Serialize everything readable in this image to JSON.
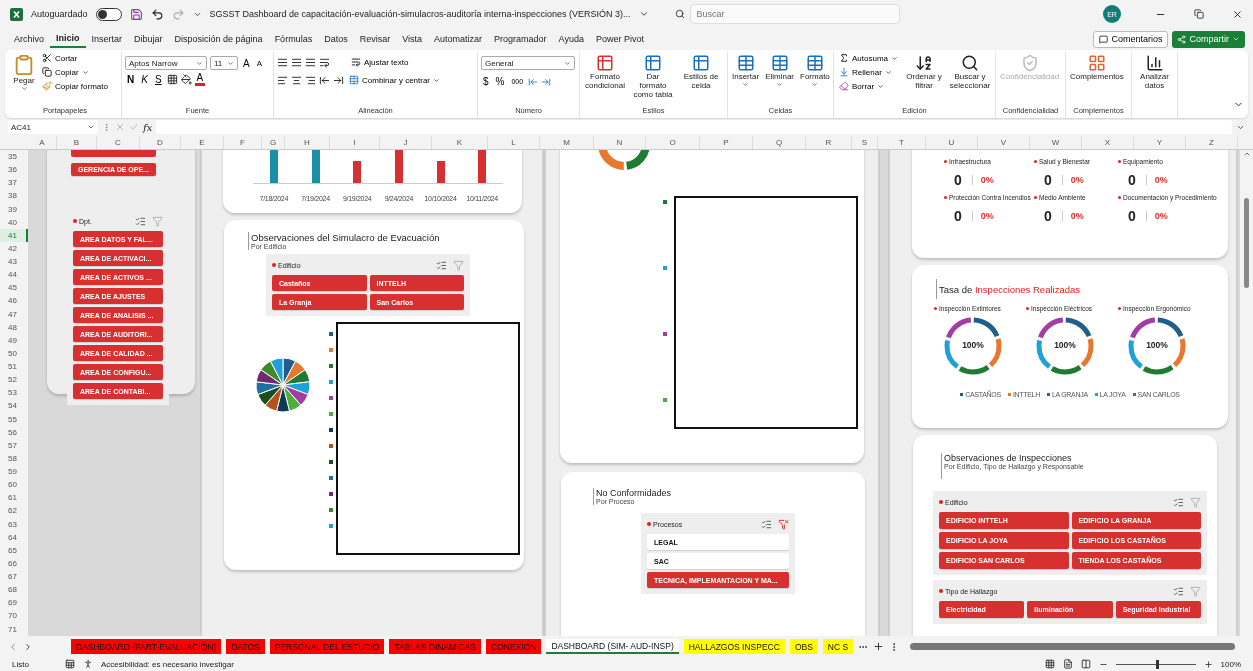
{
  "window": {
    "autosave_label": "Autoguardado",
    "autosave_on": false,
    "title": "SGSST Dashboard de capacitación-evaluación-simulacros-auditoría interna-inspecciones (VERSIÓN 3)...",
    "search_placeholder": "Buscar",
    "avatar": "ER"
  },
  "menu": {
    "tabs": [
      {
        "label": "Archivo",
        "selected": false
      },
      {
        "label": "Inicio",
        "selected": true
      },
      {
        "label": "Insertar",
        "selected": false
      },
      {
        "label": "Dibujar",
        "selected": false
      },
      {
        "label": "Disposición de página",
        "selected": false
      },
      {
        "label": "Fórmulas",
        "selected": false
      },
      {
        "label": "Datos",
        "selected": false
      },
      {
        "label": "Revisar",
        "selected": false
      },
      {
        "label": "Vista",
        "selected": false
      },
      {
        "label": "Automatizar",
        "selected": false
      },
      {
        "label": "Programador",
        "selected": false
      },
      {
        "label": "Ayuda",
        "selected": false
      },
      {
        "label": "Power Pivot",
        "selected": false
      }
    ],
    "comments": "Comentarios",
    "share": "Compartir"
  },
  "ribbon": {
    "clipboard": {
      "paste": "Pegar",
      "cut": "Cortar",
      "copy": "Copiar",
      "format_painter": "Copiar formato",
      "label": "Portapapeles"
    },
    "font": {
      "name": "Aptos Narrow",
      "size": "11",
      "grow": "A",
      "shrink": "A",
      "bold": "N",
      "italic": "K",
      "underline": "S",
      "font_color": "A",
      "label": "Fuente"
    },
    "alignment": {
      "wrap": "Ajustar texto",
      "merge": "Combinar y centrar",
      "label": "Alineación"
    },
    "number": {
      "format": "General",
      "currency": "$",
      "percent": "%",
      "thousands": "000",
      "label": "Número"
    },
    "styles": {
      "items": [
        "Formato condicional",
        "Dar formato como tabla",
        "Estilos de celda"
      ],
      "label": "Estilos"
    },
    "cells": {
      "items": [
        "Insertar",
        "Eliminar",
        "Formato"
      ],
      "label": "Celdas"
    },
    "editing": {
      "autosum": "Autosuma",
      "fill": "Rellenar",
      "clear": "Borrar",
      "sort": "Ordenar y filtrar",
      "find": "Buscar y seleccionar",
      "label": "Edición"
    },
    "sensitivity": {
      "button": "Confidencialidad",
      "disabled": true,
      "label": "Confidencialidad"
    },
    "addins": {
      "button": "Complementos",
      "label": "Complementos"
    },
    "analyze": {
      "button": "Analizar datos"
    }
  },
  "formula_bar": {
    "cell": "AC41",
    "fx": "fx"
  },
  "columns": [
    "A",
    "B",
    "C",
    "D",
    "E",
    "F",
    "G",
    "H",
    "I",
    "J",
    "K",
    "L",
    "M",
    "N",
    "O",
    "P",
    "Q",
    "R",
    "S",
    "T",
    "U",
    "V",
    "W",
    "X",
    "Y",
    "Z"
  ],
  "rows": [
    {
      "n": "35",
      "selected": false
    },
    {
      "n": "36",
      "selected": false
    },
    {
      "n": "37",
      "selected": false
    },
    {
      "n": "38",
      "selected": false
    },
    {
      "n": "39",
      "selected": false
    },
    {
      "n": "40",
      "selected": false
    },
    {
      "n": "41",
      "selected": true
    },
    {
      "n": "42",
      "selected": false
    },
    {
      "n": "43",
      "selected": false
    },
    {
      "n": "44",
      "selected": false
    },
    {
      "n": "45",
      "selected": false
    },
    {
      "n": "46",
      "selected": false
    },
    {
      "n": "47",
      "selected": false
    },
    {
      "n": "48",
      "selected": false
    },
    {
      "n": "49",
      "selected": false
    },
    {
      "n": "50",
      "selected": false
    },
    {
      "n": "51",
      "selected": false
    },
    {
      "n": "52",
      "selected": false
    },
    {
      "n": "53",
      "selected": false
    },
    {
      "n": "54",
      "selected": false
    },
    {
      "n": "55",
      "selected": false
    },
    {
      "n": "56",
      "selected": false
    },
    {
      "n": "57",
      "selected": false
    },
    {
      "n": "58",
      "selected": false
    },
    {
      "n": "59",
      "selected": false
    },
    {
      "n": "60",
      "selected": false
    },
    {
      "n": "61",
      "selected": false
    },
    {
      "n": "62",
      "selected": false
    },
    {
      "n": "63",
      "selected": false
    },
    {
      "n": "64",
      "selected": false
    },
    {
      "n": "65",
      "selected": false
    },
    {
      "n": "66",
      "selected": false
    },
    {
      "n": "67",
      "selected": false
    },
    {
      "n": "68",
      "selected": false
    },
    {
      "n": "69",
      "selected": false
    },
    {
      "n": "70",
      "selected": false
    },
    {
      "n": "71",
      "selected": false
    }
  ],
  "left_panel": {
    "top_items": [
      {
        "label": "GERENCIA DE OPE...",
        "selected": true
      }
    ],
    "dept": {
      "title": "Dpt.",
      "filtered": false,
      "items": [
        {
          "label": "AREA DATOS Y FAL...",
          "selected": true
        },
        {
          "label": "AREA DE ACTIVACI...",
          "selected": true
        },
        {
          "label": "AREA DE ACTIVOS ...",
          "selected": true
        },
        {
          "label": "AREA DE AJUSTES",
          "selected": true
        },
        {
          "label": "AREA DE ANALISIS ...",
          "selected": true
        },
        {
          "label": "AREA DE AUDITORI...",
          "selected": true
        },
        {
          "label": "AREA DE CALIDAD ...",
          "selected": true
        },
        {
          "label": "AREA DE CONFIGU...",
          "selected": true
        },
        {
          "label": "AREA DE CONTABI...",
          "selected": true
        }
      ]
    }
  },
  "bar_card": {
    "bars": [
      {
        "date": "7/18/2024",
        "color": "#1a8fa6"
      },
      {
        "date": "7/19/2024",
        "color": "#1a8fa6"
      },
      {
        "date": "9/19/2024",
        "color": "#d63030"
      },
      {
        "date": "9/24/2024",
        "color": "#d63030"
      },
      {
        "date": "10/10/2024",
        "color": "#d63030"
      },
      {
        "date": "10/11/2024",
        "color": "#d63030"
      }
    ]
  },
  "simulacro_card": {
    "title": "Observaciones del Simulacro de Evacuación",
    "subtitle": "Por Edificio",
    "slicer": {
      "title": "Edificio",
      "filtered": false,
      "items": [
        {
          "label": "Castaños",
          "selected": true
        },
        {
          "label": "INTTELH",
          "selected": true
        },
        {
          "label": "La Granja",
          "selected": true
        },
        {
          "label": "San Carlos",
          "selected": true
        }
      ]
    },
    "legend": [
      {
        "color": "#1f5f8b"
      },
      {
        "color": "#e8782f"
      },
      {
        "color": "#217a33"
      },
      {
        "color": "#1da1d8"
      },
      {
        "color": "#a23ca6"
      },
      {
        "color": "#4caf3a"
      },
      {
        "color": "#0f3b57"
      },
      {
        "color": "#b5521b"
      },
      {
        "color": "#1b4d1e"
      },
      {
        "color": "#1f6fa0"
      },
      {
        "color": "#6d2a6f"
      },
      {
        "color": "#3c8a2a"
      },
      {
        "color": "#1da1d8"
      }
    ]
  },
  "middle_card": {
    "legend": [
      {
        "color": "#217a33"
      },
      {
        "color": "#1da1d8"
      },
      {
        "color": "#a23ca6"
      },
      {
        "color": "#4caf3a"
      }
    ]
  },
  "nc_card": {
    "title": "No Conformidades",
    "subtitle": "Por Proceso",
    "slicer": {
      "title": "Procesos",
      "filtered": true,
      "items": [
        {
          "label": "LEGAL",
          "selected": false
        },
        {
          "label": "SAC",
          "selected": false
        },
        {
          "label": "TECNICA, IMPLEMANTACION Y MA...",
          "selected": true
        }
      ]
    }
  },
  "kpi_card": {
    "items": [
      {
        "label": "Infraestructura",
        "value": "0",
        "percent": "0%"
      },
      {
        "label": "Salud y Bienestar",
        "value": "0",
        "percent": "0%"
      },
      {
        "label": "Equipamiento",
        "value": "0",
        "percent": "0%"
      },
      {
        "label": "Protección Contra Incendios",
        "value": "0",
        "percent": "0%"
      },
      {
        "label": "Medio Ambiente",
        "value": "0",
        "percent": "0%"
      },
      {
        "label": "Documentación y Procedimiento",
        "value": "0",
        "percent": "0%"
      }
    ]
  },
  "tasa_card": {
    "title": "Tasa de **Inspecciones Realizadas**",
    "donuts": [
      {
        "label": "Inspección Extintores",
        "value": "100%"
      },
      {
        "label": "Inspección Eléctricos",
        "value": "100%"
      },
      {
        "label": "Inspección Ergonómico",
        "value": "100%"
      }
    ],
    "legend": [
      {
        "label": "CASTAÑOS",
        "color": "#1f5f8b"
      },
      {
        "label": "INTTELH",
        "color": "#e8782f"
      },
      {
        "label": "LA GRANJA",
        "color": "#217a33"
      },
      {
        "label": "LA JOYA",
        "color": "#1da1d8"
      },
      {
        "label": "SAN CARLOS",
        "color": "#a23ca6"
      }
    ]
  },
  "inspecciones_card": {
    "title": "Observaciones de Inspecciones",
    "subtitle": "Por Edificio, Tipo de Hallazgo y Responsable",
    "slicers": [
      {
        "title": "Edificio",
        "filtered": false,
        "items": [
          {
            "label": "EDIFICIO INTTELH",
            "selected": true
          },
          {
            "label": "EDIFICIO LA GRANJA",
            "selected": true
          },
          {
            "label": "EDIFICIO LA JOYA",
            "selected": true
          },
          {
            "label": "EDIFICIO LOS CASTAÑOS",
            "selected": true
          },
          {
            "label": "EDIFICIO SAN CARLOS",
            "selected": true
          },
          {
            "label": "TIENDA LOS CASTAÑOS",
            "selected": true
          }
        ]
      },
      {
        "title": "Tipo de Hallazgo",
        "filtered": false,
        "items": [
          {
            "label": "Electricidad",
            "selected": true
          },
          {
            "label": "Iluminación",
            "selected": true
          },
          {
            "label": "Seguridad Industrial",
            "selected": true
          }
        ]
      }
    ]
  },
  "sheet_tabs": [
    {
      "label": "DASHBOARD (PART-EVALUACIÓN)",
      "color": "#ff0000",
      "selected": false
    },
    {
      "label": "DATOS",
      "color": "#ff0000",
      "selected": false
    },
    {
      "label": "PERSONAL DEL ESTUDIO",
      "color": "#ff0000",
      "selected": false
    },
    {
      "label": "TABLAS DINAMICAS",
      "color": "#ff0000",
      "selected": false
    },
    {
      "label": "CONEXION",
      "color": "#ff0000",
      "selected": false
    },
    {
      "label": "DASHBOARD (SIM- AUD-INSP)",
      "selected": true
    },
    {
      "label": "HALLAZGOS INSPECC",
      "color": "#ffff00",
      "selected": false
    },
    {
      "label": "OBS",
      "color": "#ffff00",
      "selected": false
    },
    {
      "label": "NC S",
      "color": "#ffff00",
      "selected": false
    }
  ],
  "status": {
    "ready": "Listo",
    "accessibility": "Accesibilidad: es necesario investigar",
    "zoom": "100%"
  }
}
